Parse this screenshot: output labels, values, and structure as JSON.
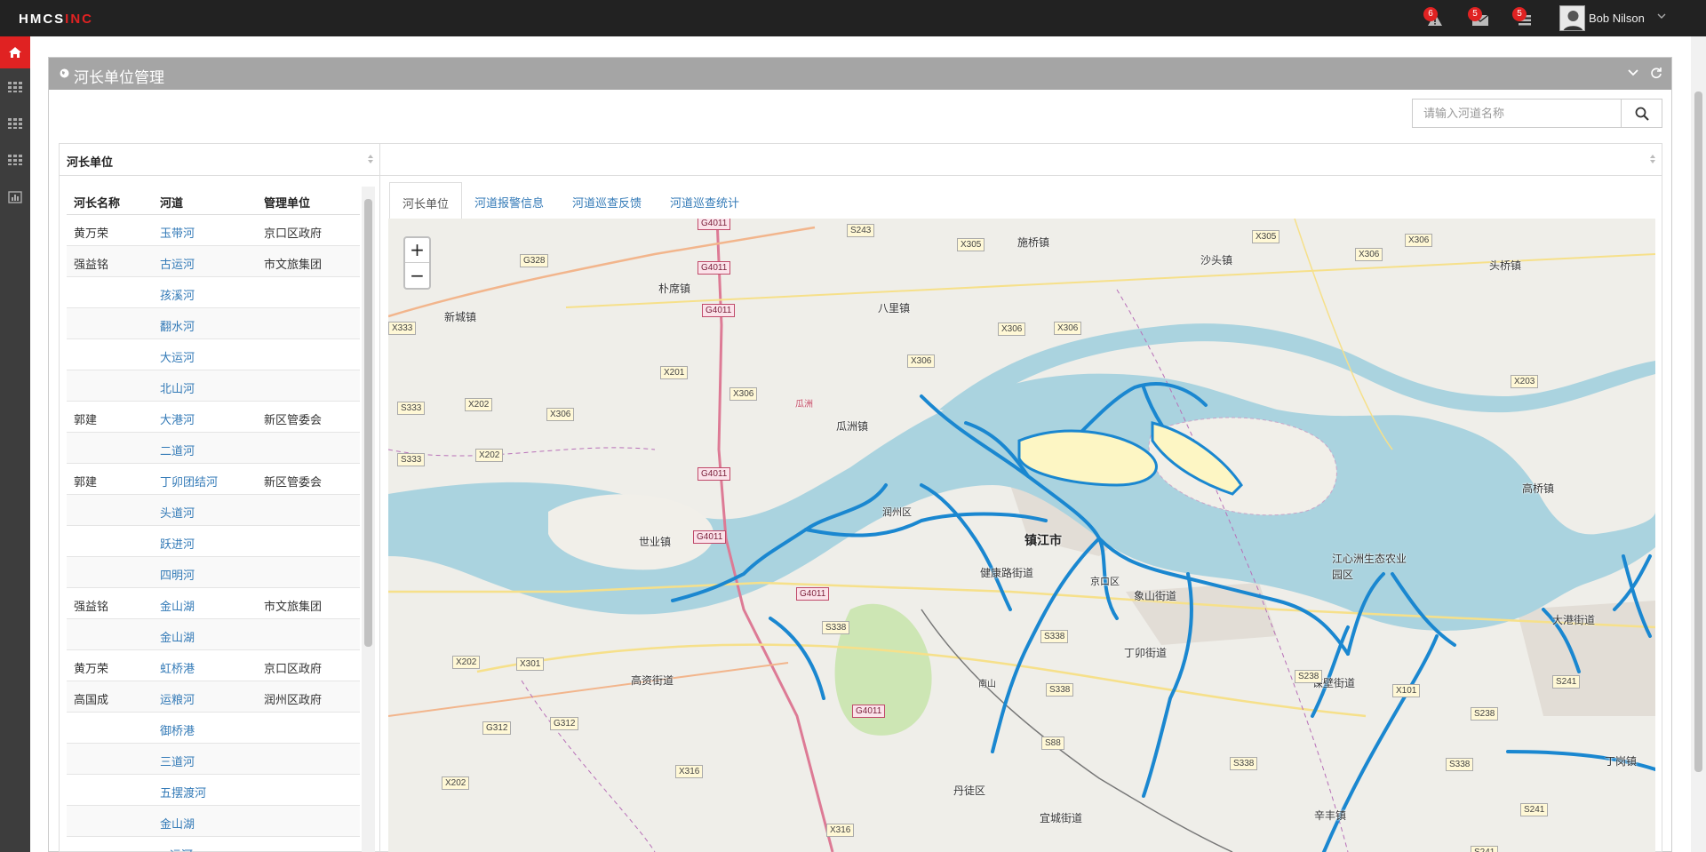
{
  "app": {
    "logo": "HMCS",
    "logo_accent": "INC",
    "accent_color": "#e02222"
  },
  "header": {
    "notifications": [
      {
        "icon": "warning-icon",
        "count": "6"
      },
      {
        "icon": "envelope-icon",
        "count": "5"
      },
      {
        "icon": "tasks-icon",
        "count": "5"
      }
    ],
    "user_name": "Bob Nilson"
  },
  "sidebar": {
    "items": [
      {
        "icon": "home-icon",
        "active": true
      },
      {
        "icon": "grid-icon"
      },
      {
        "icon": "grid-icon"
      },
      {
        "icon": "grid-icon"
      },
      {
        "icon": "bar-chart-icon"
      }
    ]
  },
  "page": {
    "title": "河长单位管理"
  },
  "search": {
    "placeholder": "请输入河道名称"
  },
  "left_panel": {
    "title": "河长单位",
    "columns": [
      "河长名称",
      "河道",
      "管理单位"
    ],
    "rows": [
      [
        "黄万荣",
        "玉带河",
        "京口区政府"
      ],
      [
        "强益铭",
        "古运河",
        "市文旅集团"
      ],
      [
        "",
        "孩溪河",
        ""
      ],
      [
        "",
        "翻水河",
        ""
      ],
      [
        "",
        "大运河",
        ""
      ],
      [
        "",
        "北山河",
        ""
      ],
      [
        "郭建",
        "大港河",
        "新区管委会"
      ],
      [
        "",
        "二道河",
        ""
      ],
      [
        "郭建",
        "丁卯团结河",
        "新区管委会"
      ],
      [
        "",
        "头道河",
        ""
      ],
      [
        "",
        "跃进河",
        ""
      ],
      [
        "",
        "四明河",
        ""
      ],
      [
        "强益铭",
        "金山湖",
        "市文旅集团"
      ],
      [
        "",
        "金山湖",
        ""
      ],
      [
        "黄万荣",
        "虹桥港",
        "京口区政府"
      ],
      [
        "高国成",
        "运粮河",
        "润州区政府"
      ],
      [
        "",
        "御桥港",
        ""
      ],
      [
        "",
        "三道河",
        ""
      ],
      [
        "",
        "五摆渡河",
        ""
      ],
      [
        "",
        "金山湖",
        ""
      ],
      [
        "",
        "...运河",
        ""
      ]
    ]
  },
  "tabs": [
    {
      "label": "河长单位",
      "active": true
    },
    {
      "label": "河道报警信息"
    },
    {
      "label": "河道巡查反馈"
    },
    {
      "label": "河道巡查统计"
    }
  ],
  "map": {
    "zoom_in": "+",
    "zoom_out": "−",
    "places": [
      {
        "name": "施桥镇"
      },
      {
        "name": "沙头镇"
      },
      {
        "name": "头桥镇"
      },
      {
        "name": "朴席镇"
      },
      {
        "name": "八里镇"
      },
      {
        "name": "新城镇"
      },
      {
        "name": "瓜洲镇"
      },
      {
        "name": "高桥镇"
      },
      {
        "name": "世业镇"
      },
      {
        "name": "润州区"
      },
      {
        "name": "镇江市"
      },
      {
        "name": "健康路街道"
      },
      {
        "name": "京口区"
      },
      {
        "name": "象山街道"
      },
      {
        "name": "江心洲生态农业园区"
      },
      {
        "name": "大港街道"
      },
      {
        "name": "丁卯街道"
      },
      {
        "name": "谏壁街道"
      },
      {
        "name": "高资街道"
      },
      {
        "name": "南山"
      },
      {
        "name": "丹徒区"
      },
      {
        "name": "宜城街道"
      },
      {
        "name": "辛丰镇"
      },
      {
        "name": "丁岗镇"
      },
      {
        "name": "瓜洲"
      }
    ],
    "roads": [
      "G4011",
      "S243",
      "X305",
      "X306",
      "G328",
      "X333",
      "S333",
      "X201",
      "X202",
      "X203",
      "S241",
      "S238",
      "S338",
      "X301",
      "G312",
      "X316",
      "X101",
      "S88"
    ],
    "water_color": "#aad3df",
    "river_line_color": "#1a87d0"
  }
}
